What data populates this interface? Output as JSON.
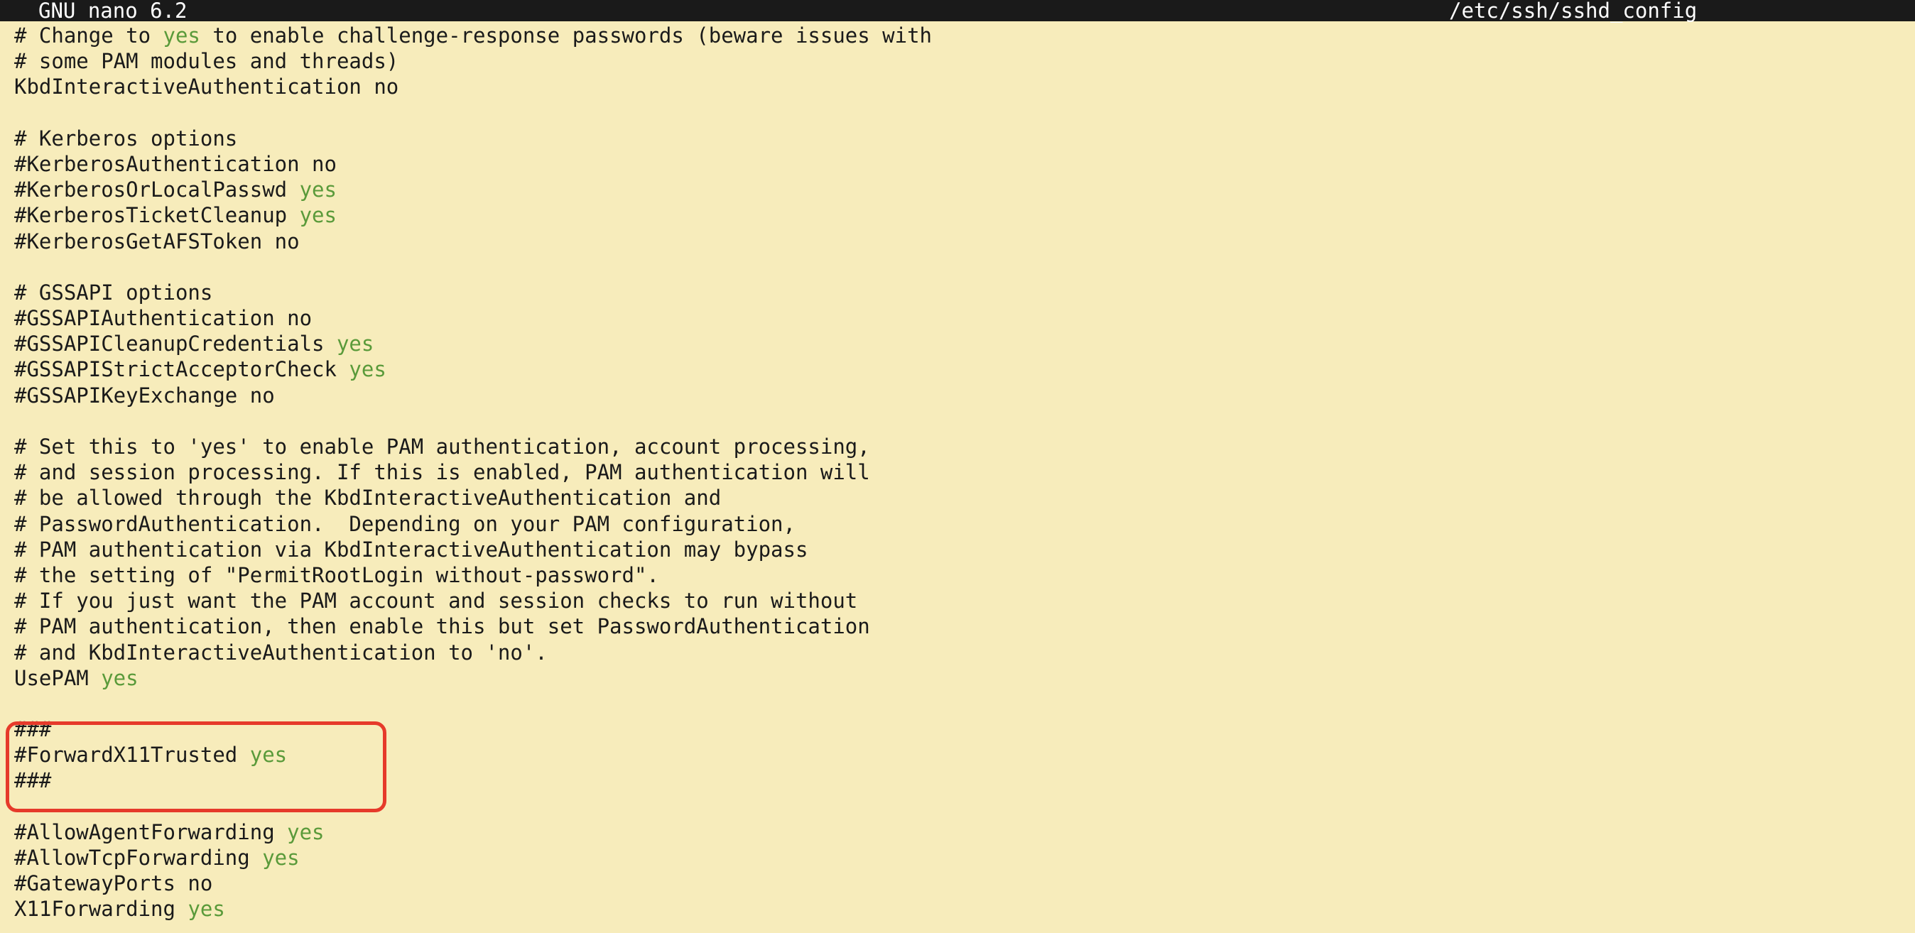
{
  "titlebar": {
    "app": "GNU nano 6.2",
    "file": "/etc/ssh/sshd_config"
  },
  "lines": [
    [
      {
        "t": "# Change to "
      },
      {
        "t": "yes",
        "g": true
      },
      {
        "t": " to enable challenge-response passwords (beware issues with"
      }
    ],
    [
      {
        "t": "# some PAM modules and threads)"
      }
    ],
    [
      {
        "t": "KbdInteractiveAuthentication no"
      }
    ],
    [
      {
        "t": ""
      }
    ],
    [
      {
        "t": "# Kerberos options"
      }
    ],
    [
      {
        "t": "#KerberosAuthentication no"
      }
    ],
    [
      {
        "t": "#KerberosOrLocalPasswd "
      },
      {
        "t": "yes",
        "g": true
      }
    ],
    [
      {
        "t": "#KerberosTicketCleanup "
      },
      {
        "t": "yes",
        "g": true
      }
    ],
    [
      {
        "t": "#KerberosGetAFSToken no"
      }
    ],
    [
      {
        "t": ""
      }
    ],
    [
      {
        "t": "# GSSAPI options"
      }
    ],
    [
      {
        "t": "#GSSAPIAuthentication no"
      }
    ],
    [
      {
        "t": "#GSSAPICleanupCredentials "
      },
      {
        "t": "yes",
        "g": true
      }
    ],
    [
      {
        "t": "#GSSAPIStrictAcceptorCheck "
      },
      {
        "t": "yes",
        "g": true
      }
    ],
    [
      {
        "t": "#GSSAPIKeyExchange no"
      }
    ],
    [
      {
        "t": ""
      }
    ],
    [
      {
        "t": "# Set this to 'yes' to enable PAM authentication, account processing,"
      }
    ],
    [
      {
        "t": "# and session processing. If this is enabled, PAM authentication will"
      }
    ],
    [
      {
        "t": "# be allowed through the KbdInteractiveAuthentication and"
      }
    ],
    [
      {
        "t": "# PasswordAuthentication.  Depending on your PAM configuration,"
      }
    ],
    [
      {
        "t": "# PAM authentication via KbdInteractiveAuthentication may bypass"
      }
    ],
    [
      {
        "t": "# the setting of \"PermitRootLogin without-password\"."
      }
    ],
    [
      {
        "t": "# If you just want the PAM account and session checks to run without"
      }
    ],
    [
      {
        "t": "# PAM authentication, then enable this but set PasswordAuthentication"
      }
    ],
    [
      {
        "t": "# and KbdInteractiveAuthentication to 'no'."
      }
    ],
    [
      {
        "t": "UsePAM "
      },
      {
        "t": "yes",
        "g": true
      }
    ],
    [
      {
        "t": ""
      }
    ],
    [
      {
        "t": "###"
      }
    ],
    [
      {
        "t": "#ForwardX11Trusted "
      },
      {
        "t": "yes",
        "g": true
      }
    ],
    [
      {
        "t": "###"
      }
    ],
    [
      {
        "t": ""
      }
    ],
    [
      {
        "t": "#AllowAgentForwarding "
      },
      {
        "t": "yes",
        "g": true
      }
    ],
    [
      {
        "t": "#AllowTcpForwarding "
      },
      {
        "t": "yes",
        "g": true
      }
    ],
    [
      {
        "t": "#GatewayPorts no"
      }
    ],
    [
      {
        "t": "X11Forwarding "
      },
      {
        "t": "yes",
        "g": true
      }
    ]
  ]
}
